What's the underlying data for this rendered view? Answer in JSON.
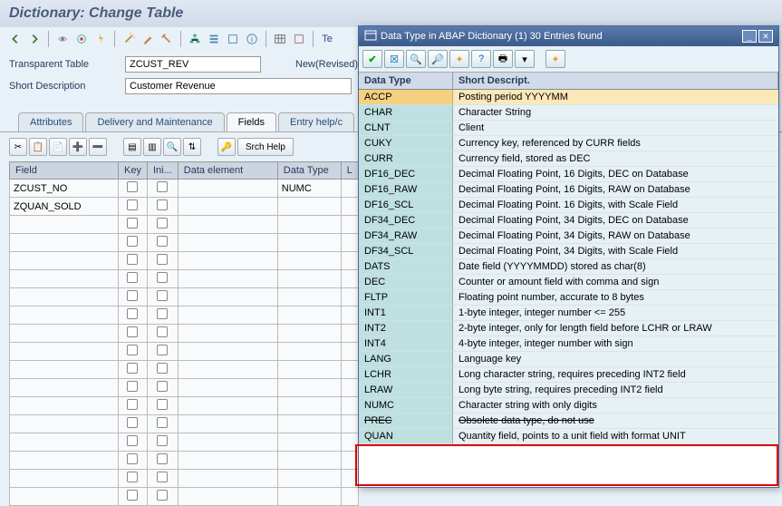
{
  "title": "Dictionary: Change Table",
  "fields": {
    "tt_label": "Transparent Table",
    "tt_value": "ZCUST_REV",
    "new_label": "New(Revised)",
    "sd_label": "Short Description",
    "sd_value": "Customer Revenue"
  },
  "tabs": {
    "t1": "Attributes",
    "t2": "Delivery and Maintenance",
    "t3": "Fields",
    "t4": "Entry help/c"
  },
  "srch_label": "Srch Help",
  "grid": {
    "h_field": "Field",
    "h_key": "Key",
    "h_ini": "Ini...",
    "h_de": "Data element",
    "h_dt": "Data Type",
    "h_l": "L",
    "r1_field": "ZCUST_NO",
    "r1_dt": "NUMC",
    "r2_field": "ZQUAN_SOLD"
  },
  "popup": {
    "title": "Data Type in ABAP Dictionary (1)   30 Entries found",
    "h_dt": "Data Type",
    "h_sd": "Short Descript.",
    "rows": [
      {
        "dt": "ACCP",
        "sd": "Posting period YYYYMM",
        "sel": true
      },
      {
        "dt": "CHAR",
        "sd": "Character String"
      },
      {
        "dt": "CLNT",
        "sd": "Client"
      },
      {
        "dt": "CUKY",
        "sd": "Currency key, referenced by CURR fields"
      },
      {
        "dt": "CURR",
        "sd": "Currency field, stored as DEC"
      },
      {
        "dt": "DF16_DEC",
        "sd": "Decimal Floating Point, 16 Digits, DEC on Database"
      },
      {
        "dt": "DF16_RAW",
        "sd": "Decimal Floating Point, 16 Digits,  RAW on Database"
      },
      {
        "dt": "DF16_SCL",
        "sd": "Decimal Floating Point. 16 Digits, with Scale Field"
      },
      {
        "dt": "DF34_DEC",
        "sd": "Decimal Floating Point, 34 Digits, DEC on Database"
      },
      {
        "dt": "DF34_RAW",
        "sd": "Decimal Floating Point, 34 Digits, RAW on Database"
      },
      {
        "dt": "DF34_SCL",
        "sd": "Decimal Floating Point, 34 Digits, with Scale Field"
      },
      {
        "dt": "DATS",
        "sd": "Date field (YYYYMMDD) stored as char(8)"
      },
      {
        "dt": "DEC",
        "sd": "Counter or amount field with comma and sign"
      },
      {
        "dt": "FLTP",
        "sd": "Floating point number, accurate to 8 bytes"
      },
      {
        "dt": "INT1",
        "sd": "1-byte integer, integer number <= 255"
      },
      {
        "dt": "INT2",
        "sd": "2-byte integer, only for length field before LCHR or LRAW"
      },
      {
        "dt": "INT4",
        "sd": "4-byte integer, integer number with sign"
      },
      {
        "dt": "LANG",
        "sd": "Language key"
      },
      {
        "dt": "LCHR",
        "sd": "Long character string, requires preceding INT2 field"
      },
      {
        "dt": "LRAW",
        "sd": "Long byte string, requires preceding INT2 field"
      },
      {
        "dt": "NUMC",
        "sd": "Character string with only digits"
      },
      {
        "dt": "PREC",
        "sd": "Obsolete data type, do not use",
        "strike": true
      },
      {
        "dt": "QUAN",
        "sd": "Quantity field, points to a unit field with format UNIT"
      }
    ]
  }
}
